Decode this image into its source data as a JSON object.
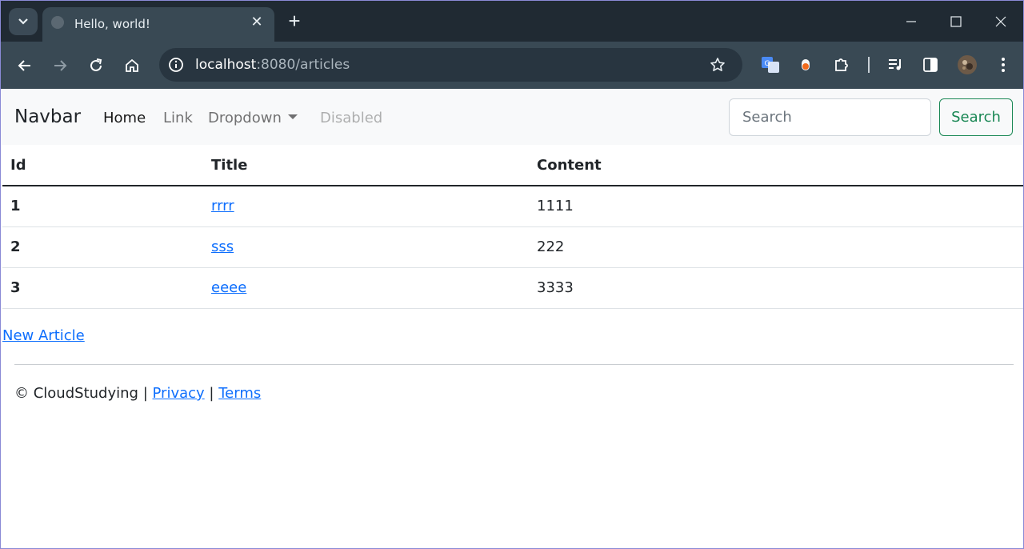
{
  "browser": {
    "tab_title": "Hello, world!",
    "tab_close": "✕",
    "new_tab": "+",
    "url_host": "localhost",
    "url_rest": ":8080/articles"
  },
  "navbar": {
    "brand": "Navbar",
    "links": [
      {
        "label": "Home"
      },
      {
        "label": "Link"
      },
      {
        "label": "Dropdown"
      },
      {
        "label": "Disabled"
      }
    ],
    "search_placeholder": "Search",
    "search_button": "Search"
  },
  "table": {
    "headers": [
      "Id",
      "Title",
      "Content"
    ],
    "rows": [
      {
        "id": "1",
        "title": "rrrr",
        "content": "1111"
      },
      {
        "id": "2",
        "title": "sss",
        "content": "222"
      },
      {
        "id": "3",
        "title": "eeee",
        "content": "3333"
      }
    ]
  },
  "new_article_link": "New Article",
  "footer": {
    "copyright": "© CloudStudying",
    "sep1": "|",
    "privacy": "Privacy",
    "sep2": "|",
    "terms": "Terms"
  },
  "colors": {
    "tabstrip": "#202a33",
    "toolbar": "#394954",
    "link": "#0d6efd",
    "success": "#198754"
  },
  "icons": [
    "tab-search-icon",
    "globe-icon",
    "close-icon",
    "plus-icon",
    "minimize-icon",
    "maximize-icon",
    "window-close-icon",
    "back-icon",
    "forward-icon",
    "reload-icon",
    "home-icon",
    "info-icon",
    "star-icon",
    "translate-icon",
    "extension-record-icon",
    "puzzle-icon",
    "media-icon",
    "side-panel-icon",
    "avatar",
    "kebab-menu-icon"
  ]
}
